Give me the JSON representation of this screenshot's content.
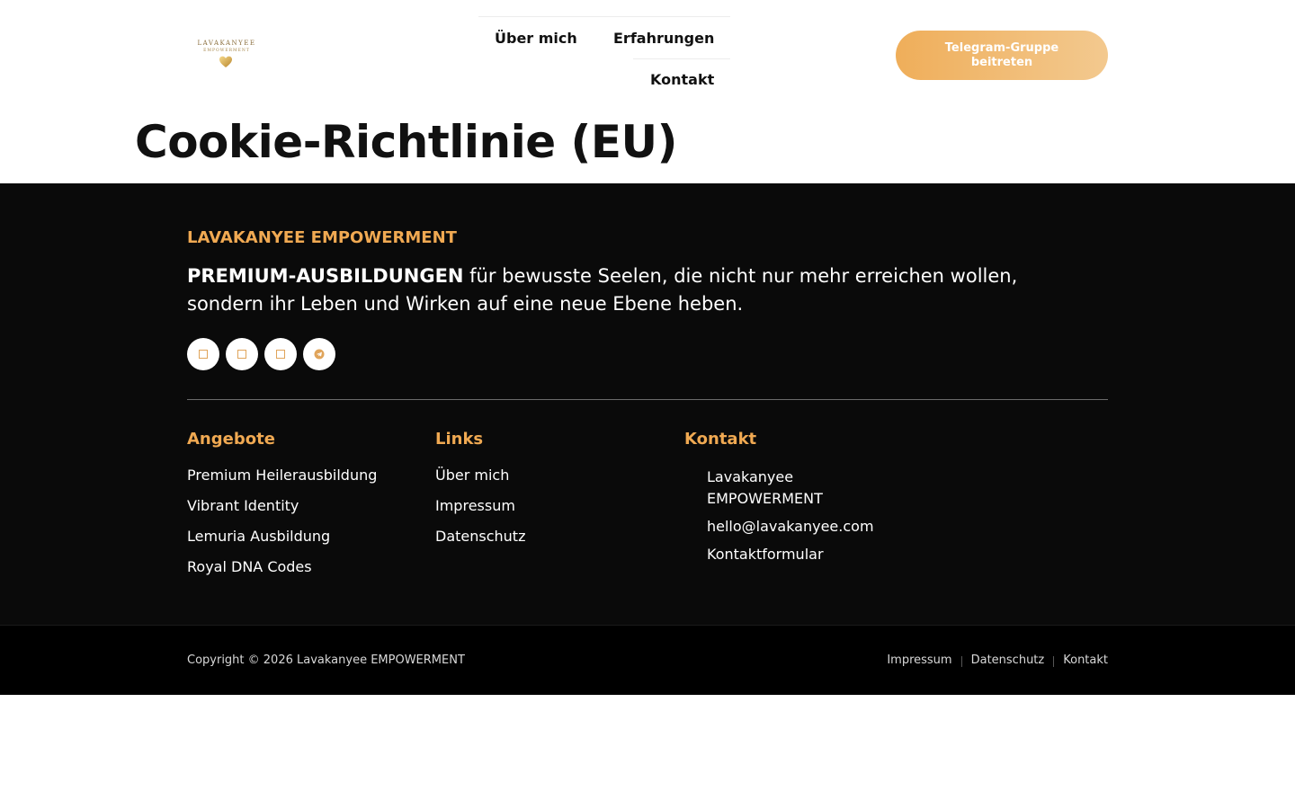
{
  "header": {
    "logo": {
      "title": "LAVAKANYEE",
      "subtitle": "EMPOWERMENT"
    },
    "nav": [
      {
        "label": "Über mich"
      },
      {
        "label": "Erfahrungen"
      },
      {
        "label": "Kontakt"
      }
    ],
    "cta_label": "Telegram-Gruppe beitreten"
  },
  "page_title": "Cookie-Richtlinie (EU)",
  "footer": {
    "brand": "LAVAKANYEE EMPOWERMENT",
    "tagline_strong": "PREMIUM-AUSBILDUNGEN",
    "tagline_rest": " für bewusste Seelen, die nicht nur mehr erreichen wollen, sondern ihr Leben und Wirken auf eine neue Ebene heben.",
    "socials": [
      {
        "icon": "facebook-icon"
      },
      {
        "icon": "instagram-icon"
      },
      {
        "icon": "youtube-icon"
      },
      {
        "icon": "telegram-icon"
      }
    ],
    "columns": {
      "offers": {
        "title": "Angebote",
        "links": [
          "Premium Heilerausbildung",
          "Vibrant Identity",
          "Lemuria Ausbildung",
          "Royal DNA Codes"
        ]
      },
      "links": {
        "title": "Links",
        "links": [
          "Über mich",
          "Impressum",
          "Datenschutz"
        ]
      },
      "contact": {
        "title": "Kontakt",
        "links": [
          "Lavakanyee EMPOWERMENT",
          "hello@lavakanyee.com",
          "Kontaktformular"
        ]
      }
    },
    "copyright": "Copyright © 2026 Lavakanyee EMPOWERMENT",
    "legal": [
      "Impressum",
      "Datenschutz",
      "Kontakt"
    ]
  },
  "colors": {
    "accent": "#f0a952",
    "footer_bg": "#0a0a0a",
    "cta_start": "#efae5a",
    "cta_end": "#f3c98f"
  }
}
